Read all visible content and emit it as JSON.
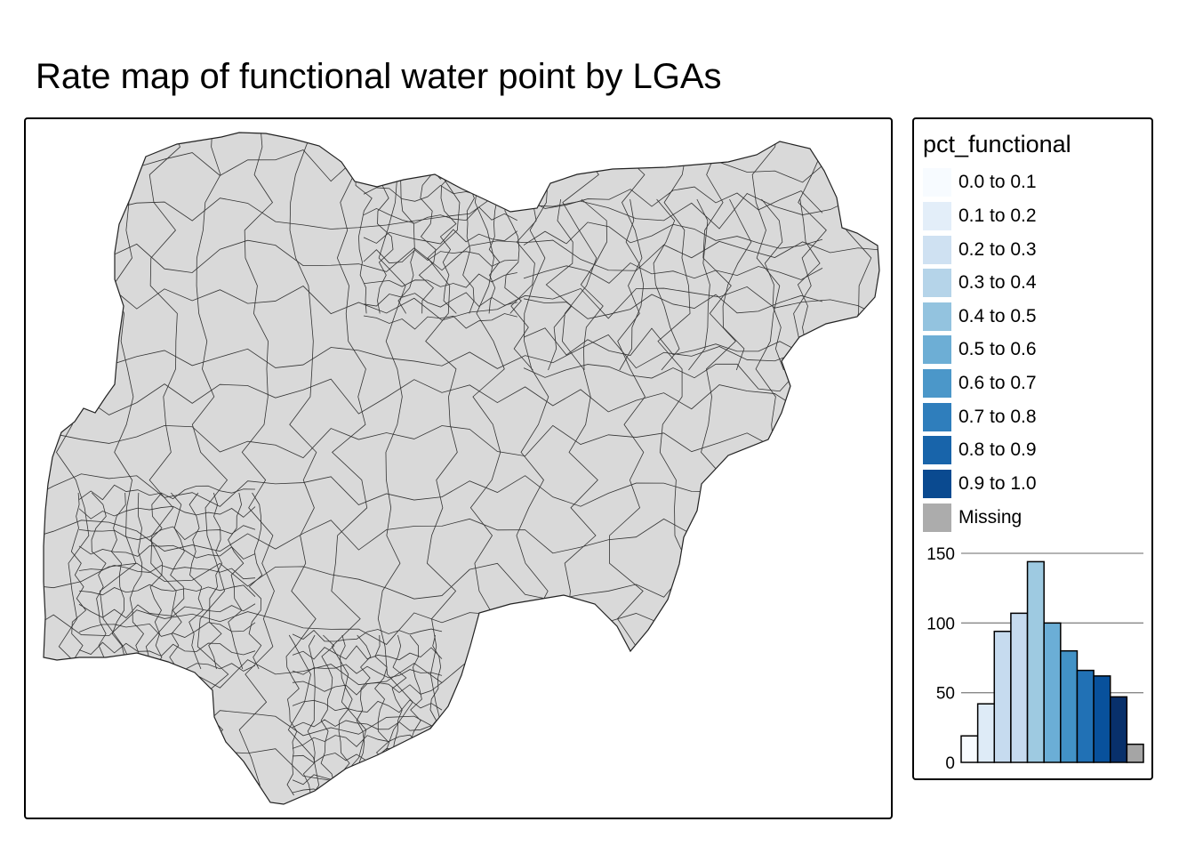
{
  "map": {
    "title": "Rate map of functional water point by LGAs",
    "fill_color": "#D9D9D9",
    "border_color": "#333333"
  },
  "legend": {
    "title": "pct_functional",
    "items": [
      {
        "label": "0.0 to 0.1",
        "color": "#F7FBFF"
      },
      {
        "label": "0.1 to 0.2",
        "color": "#E3EEF9"
      },
      {
        "label": "0.2 to 0.3",
        "color": "#CFE1F2"
      },
      {
        "label": "0.3 to 0.4",
        "color": "#B5D4E9"
      },
      {
        "label": "0.4 to 0.5",
        "color": "#93C3DF"
      },
      {
        "label": "0.5 to 0.6",
        "color": "#6DAED5"
      },
      {
        "label": "0.6 to 0.7",
        "color": "#4B97C9"
      },
      {
        "label": "0.7 to 0.8",
        "color": "#2F7EBC"
      },
      {
        "label": "0.8 to 0.9",
        "color": "#1864AA"
      },
      {
        "label": "0.9 to 1.0",
        "color": "#0A4A90"
      },
      {
        "label": "Missing",
        "color": "#ACACAC"
      }
    ]
  },
  "chart_data": {
    "type": "bar",
    "categories": [
      "0.0 to 0.1",
      "0.1 to 0.2",
      "0.2 to 0.3",
      "0.3 to 0.4",
      "0.4 to 0.5",
      "0.5 to 0.6",
      "0.6 to 0.7",
      "0.7 to 0.8",
      "0.8 to 0.9",
      "0.9 to 1.0",
      "Missing"
    ],
    "values": [
      19,
      42,
      94,
      107,
      144,
      100,
      80,
      66,
      62,
      47,
      13
    ],
    "colors": [
      "#F7FBFF",
      "#DEEBF7",
      "#C6DBEF",
      "#C6DBEF",
      "#9ECAE1",
      "#6BAED6",
      "#4292C6",
      "#2171B5",
      "#08519C",
      "#08306B",
      "#A5A5A5"
    ],
    "yticks": [
      0,
      50,
      100,
      150
    ],
    "ylim": [
      0,
      150
    ],
    "grid": true
  }
}
